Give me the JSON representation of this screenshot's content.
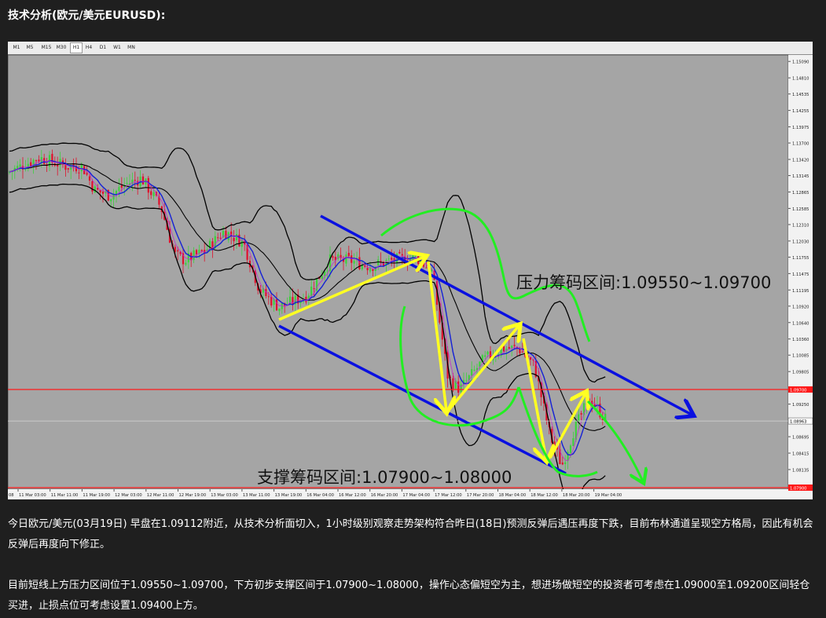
{
  "title": "技术分析(欧元/美元EURUSD):",
  "timeframes": [
    "M1",
    "M5",
    "M15",
    "M30",
    "H1",
    "H4",
    "D1",
    "W1",
    "MN"
  ],
  "active_timeframe": "H1",
  "chart_data": {
    "type": "candlestick",
    "symbol": "EURUSD",
    "timeframe": "H1",
    "y_ticks": [
      "1.15090",
      "1.14810",
      "1.14535",
      "1.14255",
      "1.13975",
      "1.13700",
      "1.13420",
      "1.13145",
      "1.12865",
      "1.12585",
      "1.12310",
      "1.12030",
      "1.11755",
      "1.11475",
      "1.11195",
      "1.10920",
      "1.10640",
      "1.10360",
      "1.10085",
      "1.09805",
      "1.09250",
      "1.08695",
      "1.08415",
      "1.08135"
    ],
    "x_ticks": [
      "11 Mar 03:00",
      "11 Mar 11:00",
      "11 Mar 19:00",
      "12 Mar 03:00",
      "12 Mar 11:00",
      "12 Mar 19:00",
      "13 Mar 03:00",
      "13 Mar 11:00",
      "13 Mar 19:00",
      "16 Mar 04:00",
      "16 Mar 12:00",
      "16 Mar 20:00",
      "17 Mar 04:00",
      "17 Mar 12:00",
      "17 Mar 20:00",
      "18 Mar 04:00",
      "18 Mar 12:00",
      "18 Mar 20:00",
      "19 Mar 04:00"
    ],
    "x_first_partial": "08",
    "current_price_label": "1.08963",
    "red_line_labels": [
      "1.09700",
      "1.07900"
    ],
    "ylim": [
      1.078,
      1.152
    ],
    "resistance_label": "压力筹码区间:1.09550~1.09700",
    "support_label": "支撑筹码区间:1.07900~1.08000",
    "resistance_levels": [
      1.0955,
      1.097
    ],
    "support_levels": [
      1.079,
      1.08
    ],
    "colors": {
      "background": "#a5a5a5",
      "bull": "#3cd13c",
      "bear": "#e0102b",
      "band": "#000000",
      "ma": "#1420d6",
      "channel": "#0a10e0",
      "arrow": "#ffff22",
      "hand_curve": "#22ee22",
      "level_line": "#ff1a1a"
    }
  },
  "paragraphs": [
    "今日欧元/美元(03月19日) 早盘在1.09112附近，从技术分析面切入，1小时级别观察走势架构符合昨日(18日)预测反弹后遇压再度下跌，目前布林通道呈现空方格局，因此有机会反弹后再度向下修正。",
    "目前短线上方压力区间位于1.09550~1.09700，下方初步支撑区间于1.07900~1.08000，操作心态偏短空为主，想进场做短空的投资者可考虑在1.09000至1.09200区间轻仓买进，止损点位可考虑设置1.09400上方。"
  ]
}
